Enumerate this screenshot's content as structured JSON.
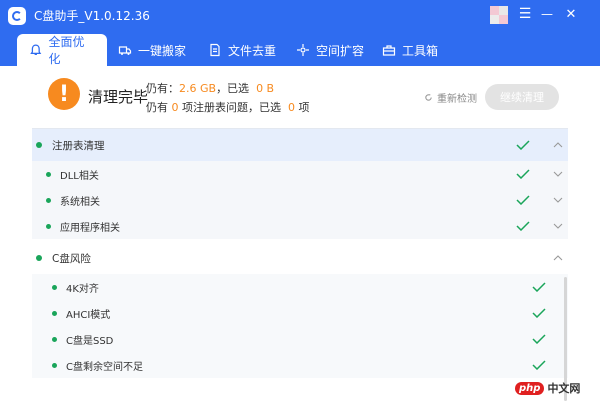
{
  "window": {
    "title": "C盘助手_V1.0.12.36",
    "controls": {
      "menu": "☰",
      "minimize": "—",
      "close": "✕"
    }
  },
  "tabs": [
    {
      "label": "全面优化",
      "icon": "bell-icon",
      "active": true
    },
    {
      "label": "一键搬家",
      "icon": "truck-icon",
      "active": false
    },
    {
      "label": "文件去重",
      "icon": "document-icon",
      "active": false
    },
    {
      "label": "空间扩容",
      "icon": "expand-icon",
      "active": false
    },
    {
      "label": "工具箱",
      "icon": "toolbox-icon",
      "active": false
    }
  ],
  "summary": {
    "status_icon": "!",
    "status": "清理完毕",
    "line1": {
      "prefix": "仍有：",
      "size": "2.6 GB",
      "sep": "，已选",
      "selected": "0 B"
    },
    "line2": {
      "prefix": "仍有",
      "count": "0",
      "mid": "项注册表问题，已选",
      "selected": "0",
      "suffix": "项"
    },
    "recheck_label": "重新检测",
    "continue_label": "继续清理"
  },
  "sections": [
    {
      "label": "注册表清理",
      "expanded": true,
      "items": [
        {
          "label": "DLL相关"
        },
        {
          "label": "系统相关"
        },
        {
          "label": "应用程序相关"
        }
      ]
    },
    {
      "label": "C盘风险",
      "expanded": true,
      "items": [
        {
          "label": "4K对齐"
        },
        {
          "label": "AHCI模式"
        },
        {
          "label": "C盘是SSD"
        },
        {
          "label": "C盘剩余空间不足"
        }
      ]
    }
  ],
  "watermark": {
    "logo": "php",
    "text": "中文网"
  },
  "colors": {
    "brand": "#2f6cf0",
    "warning": "#f78a1f",
    "success": "#1aa55a"
  }
}
